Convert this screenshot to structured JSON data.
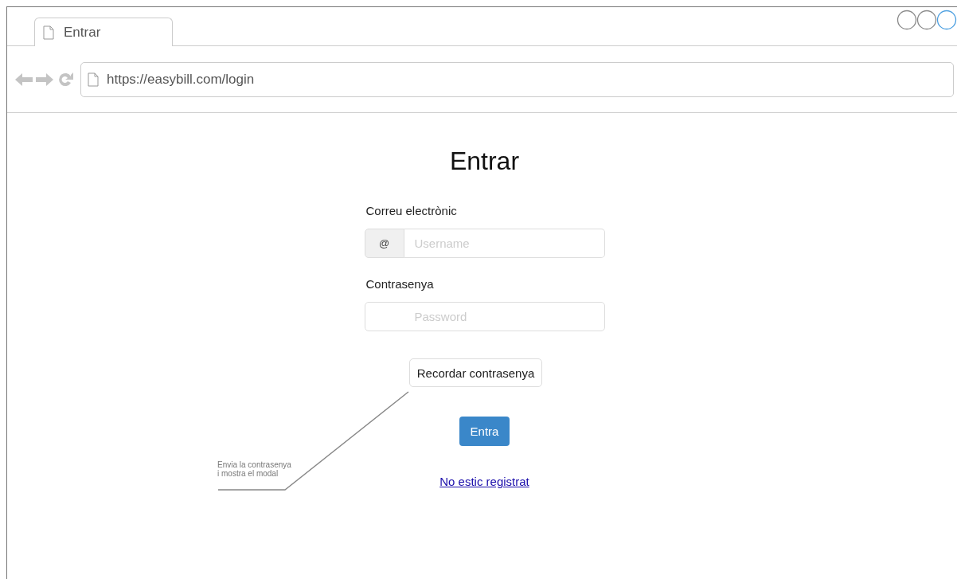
{
  "browser": {
    "tab": {
      "title": "Entrar"
    },
    "address": "https://easybill.com/login"
  },
  "page": {
    "title": "Entrar",
    "fields": [
      {
        "label": "Correu electrònic",
        "prefix": "@",
        "placeholder": "Username"
      },
      {
        "label": "Contrasenya",
        "placeholder": "Password"
      }
    ],
    "remind_button": "Recordar contrasenya",
    "submit_button": "Entra",
    "register_link": "No estic registrat"
  },
  "annotation": {
    "lines": [
      "Envia la contrasenya",
      "i mostra el modal"
    ]
  }
}
